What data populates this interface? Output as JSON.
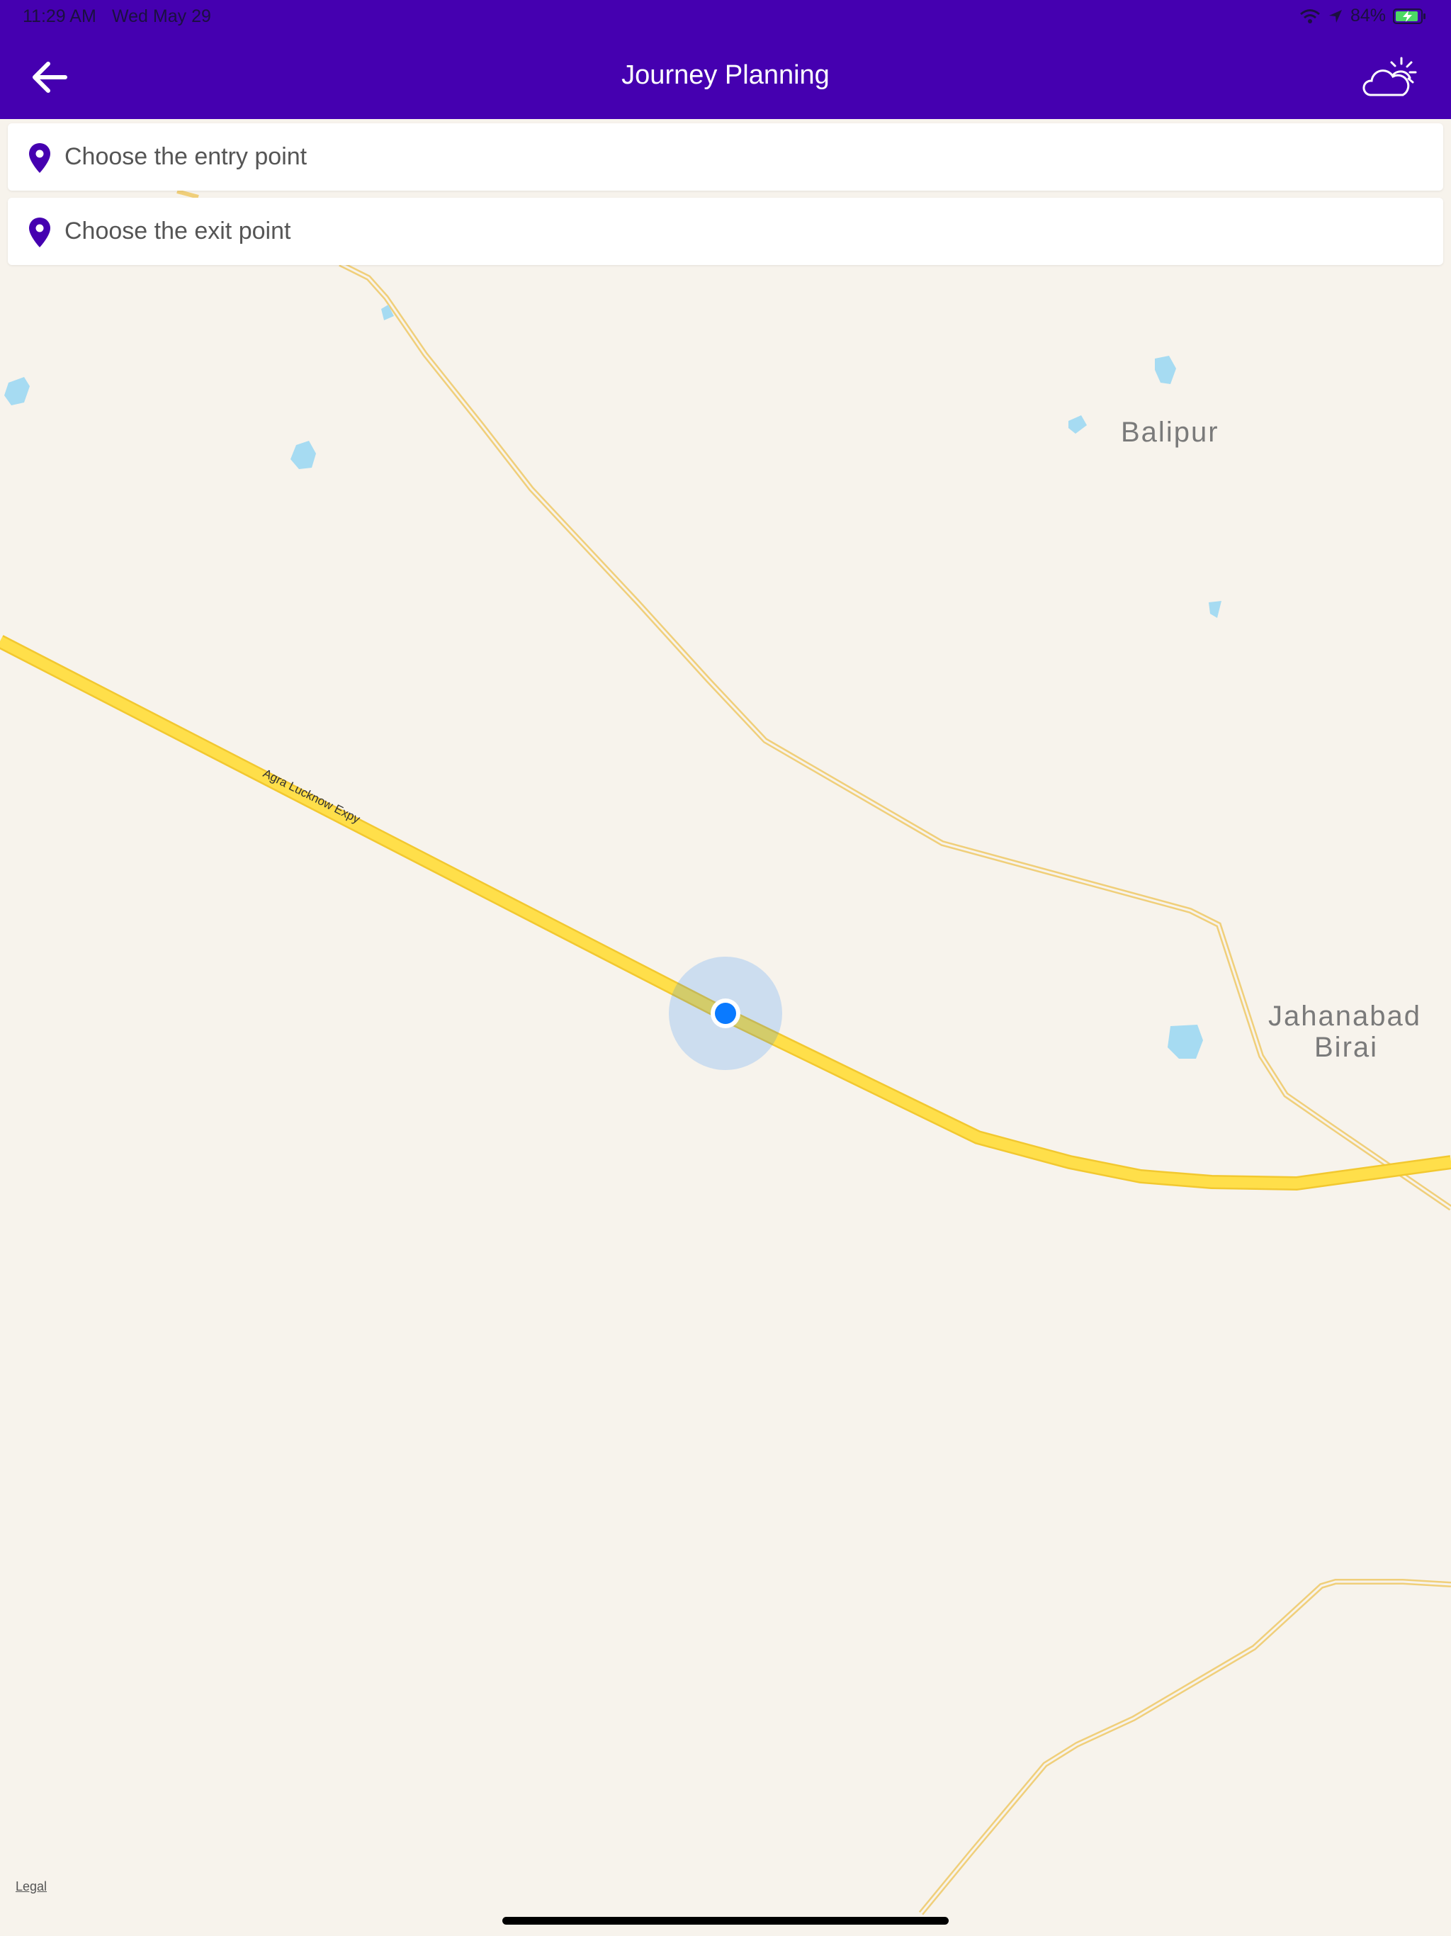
{
  "status_bar": {
    "time": "11:29 AM",
    "date": "Wed May 29",
    "battery": "84%"
  },
  "header": {
    "title": "Journey Planning",
    "back_icon": "arrow-left-icon",
    "weather_icon": "partly-cloudy-icon"
  },
  "search": {
    "entry_placeholder": "Choose the entry point",
    "exit_placeholder": "Choose the exit point"
  },
  "map": {
    "road_label": "Agra Lucknow Expy",
    "places": [
      "Balipur",
      "Jahanabad",
      "Birai"
    ],
    "legal_label": "Legal"
  },
  "colors": {
    "brand": "#4500b0",
    "highway": "#ffdd44",
    "minor_road": "#f5d98a",
    "water": "#a6dbf2",
    "user_location": "#0a7aff"
  }
}
